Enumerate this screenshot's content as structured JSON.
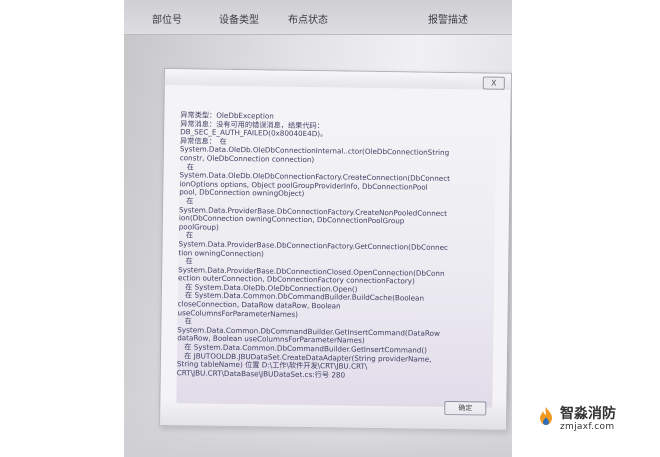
{
  "table_header": {
    "col1": "部位号",
    "col2": "设备类型",
    "col3": "布点状态",
    "col4": "报警描述"
  },
  "dialog": {
    "close_label": "X",
    "lines": [
      "异常类型：OleDbException",
      "异常消息：没有可用的错误消息，结果代码：",
      "DB_SEC_E_AUTH_FAILED(0x80040E4D)。",
      "异常信息：　在",
      "System.Data.OleDb.OleDbConnectionInternal..ctor(OleDbConnectionString",
      "constr, OleDbConnection connection)",
      "　在",
      "System.Data.OleDb.OleDbConnectionFactory.CreateConnection(DbConnect",
      "ionOptions options, Object poolGroupProviderInfo, DbConnectionPool",
      "pool, DbConnection owningObject)",
      "　在",
      "System.Data.ProviderBase.DbConnectionFactory.CreateNonPooledConnect",
      "ion(DbConnection owningConnection, DbConnectionPoolGroup",
      "poolGroup)",
      "　在",
      "System.Data.ProviderBase.DbConnectionFactory.GetConnection(DbConnec",
      "tion owningConnection)",
      "　在",
      "System.Data.ProviderBase.DbConnectionClosed.OpenConnection(DbConn",
      "ection outerConnection, DbConnectionFactory connectionFactory)",
      "　在 System.Data.OleDb.OleDbConnection.Open()",
      "　在 System.Data.Common.DbCommandBuilder.BuildCache(Boolean",
      "closeConnection, DataRow dataRow, Boolean",
      "useColumnsForParameterNames)",
      "　在",
      "System.Data.Common.DbCommandBuilder.GetInsertCommand(DataRow",
      "dataRow, Boolean useColumnsForParameterNames)",
      "　在 System.Data.Common.DbCommandBuilder.GetInsertCommand()",
      "　在 JBUTOOLDB.JBUDataSet.CreateDataAdapter(String providerName,",
      "String tableName) 位置 D:\\工作\\软件开发\\CRT\\JBU.CRT\\",
      "CRT\\JBU.CRT\\DataBase\\JBUDataSet.cs:行号 280"
    ],
    "ok_label": "确定"
  },
  "watermark": {
    "name": "智淼消防",
    "site": "zmjaxf.com"
  },
  "colors": {
    "dialog_text": "#3e3f63",
    "dialog_bg": "#f4f3f6",
    "watermark_orange": "#f29a1f",
    "watermark_blue": "#2f6fb6"
  }
}
